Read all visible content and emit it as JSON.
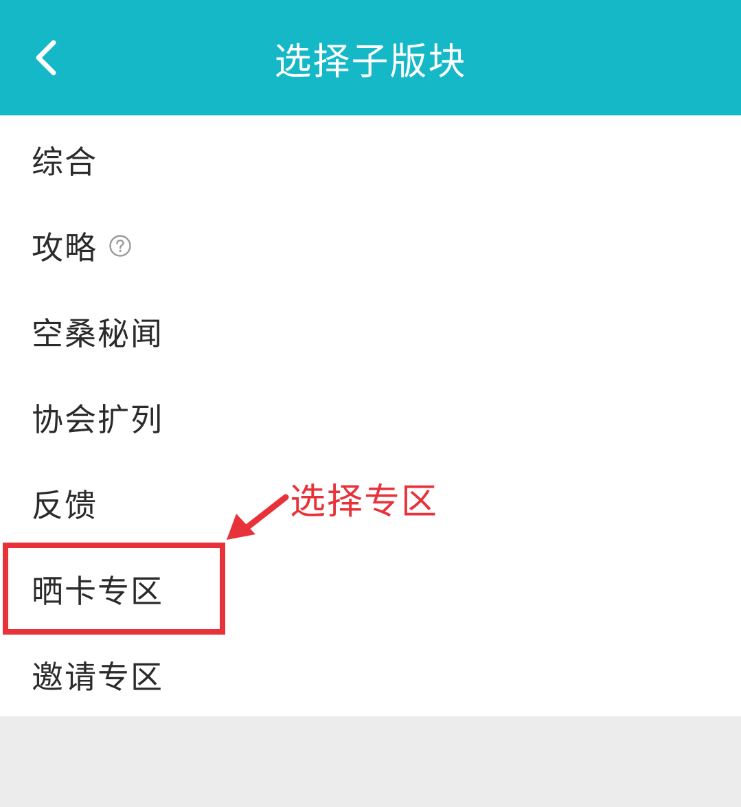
{
  "header": {
    "title": "选择子版块",
    "back_icon": "chevron-left-icon"
  },
  "list": {
    "items": [
      {
        "label": "综合"
      },
      {
        "label": "攻略",
        "icon": "help-circle-icon"
      },
      {
        "label": "空桑秘闻"
      },
      {
        "label": "协会扩列"
      },
      {
        "label": "反馈"
      },
      {
        "label": "晒卡专区"
      },
      {
        "label": "邀请专区"
      }
    ]
  },
  "annotation": {
    "text": "选择专区",
    "arrow_icon": "arrow-icon",
    "color": "#e8323a"
  },
  "colors": {
    "header_bg": "#14b8c6",
    "page_bg": "#ececec",
    "list_bg": "#ffffff",
    "text": "#2b2b2b",
    "annotation": "#e8323a"
  }
}
